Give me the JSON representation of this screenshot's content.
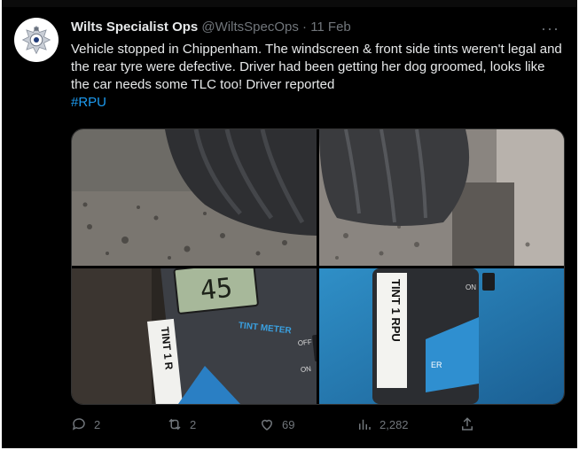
{
  "tweet": {
    "display_name": "Wilts Specialist Ops",
    "handle": "@WiltsSpecOps",
    "separator": "·",
    "date": "11 Feb",
    "more_label": "···",
    "text": "Vehicle stopped in Chippenham. The windscreen & front side tints weren't legal and the rear tyre were defective. Driver had been getting her dog groomed, looks like the car needs some TLC too! Driver reported",
    "hashtag": "#RPU"
  },
  "media": {
    "meter_reading": "45",
    "meter_label": "TINT METER",
    "meter_off": "OFF",
    "meter_on": "ON",
    "sticker_1": "TINT 1 R",
    "sticker_2": "TINT 1 RPU",
    "device_on": "ON",
    "device_partial": "ER"
  },
  "actions": {
    "replies": "2",
    "reposts": "2",
    "likes": "69",
    "views": "2,282"
  },
  "colors": {
    "accent": "#1d9bf0",
    "muted": "#71767b",
    "text": "#e7e9ea"
  }
}
